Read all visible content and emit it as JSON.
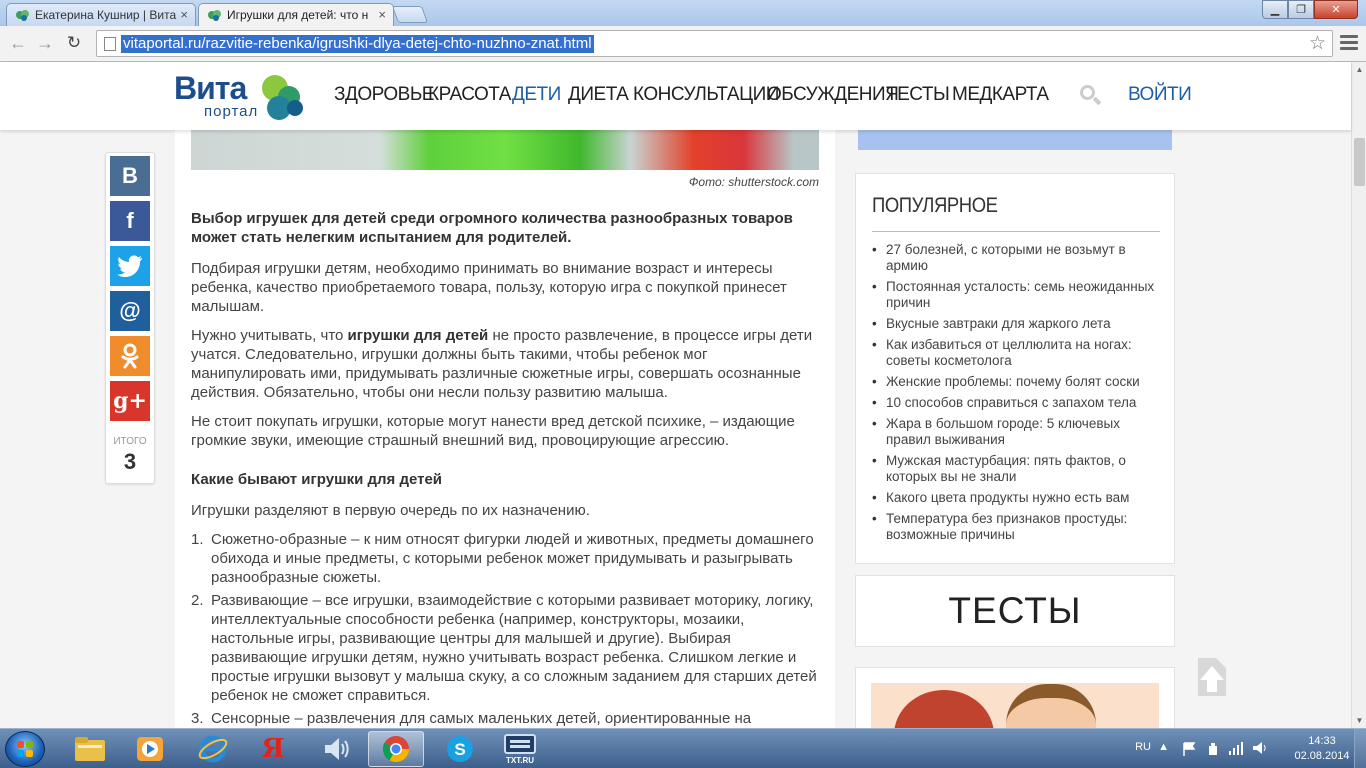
{
  "browser": {
    "tabs": [
      {
        "title": "Екатерина Кушнир | Вита",
        "active": false
      },
      {
        "title": "Игрушки для детей: что н",
        "active": true
      }
    ],
    "url": "vitaportal.ru/razvitie-rebenka/igrushki-dlya-detej-chto-nuzhno-znat.html"
  },
  "site": {
    "logo_top": "Вита",
    "logo_bottom": "портал",
    "nav": [
      "ЗДОРОВЬЕ",
      "КРАСОТА",
      "ДЕТИ",
      "ДИЕТА",
      "КОНСУЛЬТАЦИИ",
      "ОБСУЖДЕНИЯ",
      "ТЕСТЫ",
      "МЕДКАРТА"
    ],
    "active_nav": "ДЕТИ",
    "login": "ВОЙТИ",
    "accent_color": "#1d5ea8"
  },
  "share": {
    "buttons": [
      {
        "label": "В",
        "network": "vkontakte",
        "color": "#4a6d94"
      },
      {
        "label": "f",
        "network": "facebook",
        "color": "#3b5998"
      },
      {
        "label": "🐦",
        "network": "twitter",
        "color": "#1da1e8"
      },
      {
        "label": "@",
        "network": "mail-ru",
        "color": "#1f5f9c"
      },
      {
        "label": "ок",
        "network": "odnoklassniki",
        "color": "#f08c2c"
      },
      {
        "label": "g+",
        "network": "google-plus",
        "color": "#d9362b"
      }
    ],
    "total_label": "ИТОГО",
    "total_value": "3"
  },
  "article": {
    "photo_credit": "Фото: shutterstock.com",
    "lead": "Выбор игрушек для детей среди огромного количества разнообразных товаров может стать нелегким испытанием для родителей.",
    "p1": "Подбирая игрушки детям, необходимо принимать во внимание возраст и интересы ребенка, качество приобретаемого товара, пользу, которую игра с покупкой принесет малышам.",
    "p2_before": "Нужно учитывать, что ",
    "p2_bold": "игрушки для детей",
    "p2_after": " не просто развлечение, в процессе игры дети учатся. Следовательно, игрушки должны быть такими, чтобы ребенок мог манипулировать ими, придумывать различные сюжетные игры, совершать осознанные действия. Обязательно, чтобы они несли пользу развитию малыша.",
    "p3": "Не стоит покупать игрушки, которые могут нанести вред детской психике, – издающие громкие звуки, имеющие страшный внешний вид, провоцирующие агрессию.",
    "h3": "Какие бывают игрушки для детей",
    "p4": "Игрушки разделяют в первую очередь по их назначению.",
    "list": [
      {
        "num": "1.",
        "text": "Сюжетно-образные – к ним относят фигурки людей и животных, предметы домашнего обихода и иные предметы, с которыми ребенок может придумывать и разыгрывать разнообразные сюжеты."
      },
      {
        "num": "2.",
        "text": "Развивающие – все игрушки, взаимодействие с которыми развивает моторику, логику, интеллектуальные способности ребенка (например, конструкторы, мозаики, настольные игры, развивающие центры для малышей и другие). Выбирая развивающие игрушки детям, нужно учитывать возраст ребенка. Слишком легкие и простые игрушки вызовут у малыша скуку, а со сложным заданием для старших детей ребенок не сможет справиться."
      },
      {
        "num": "3.",
        "text": "Сенсорные – развлечения для самых маленьких детей, ориентированные на"
      }
    ]
  },
  "sidebar": {
    "popular_title": "ПОПУЛЯРНОЕ",
    "popular": [
      "27 болезней, с которыми не возьмут в армию",
      "Постоянная усталость: семь неожиданных причин",
      "Вкусные завтраки для жаркого лета",
      "Как избавиться от целлюлита на ногах: советы косметолога",
      "Женские проблемы: почему болят соски",
      "10 способов справиться с запахом тела",
      "Жара в большом городе: 5 ключевых правил выживания",
      "Мужская мастурбация: пять фактов, о которых вы не знали",
      "Какого цвета продукты нужно есть вам",
      "Температура без признаков простуды: возможные причины"
    ],
    "tests_title": "ТЕСТЫ"
  },
  "taskbar": {
    "apps": [
      "explorer",
      "media-player",
      "internet-explorer",
      "yandex",
      "volume",
      "chrome",
      "skype",
      "txt-ru"
    ],
    "txt_label": "TXT.RU",
    "language": "RU",
    "time": "14:33",
    "date": "02.08.2014"
  }
}
